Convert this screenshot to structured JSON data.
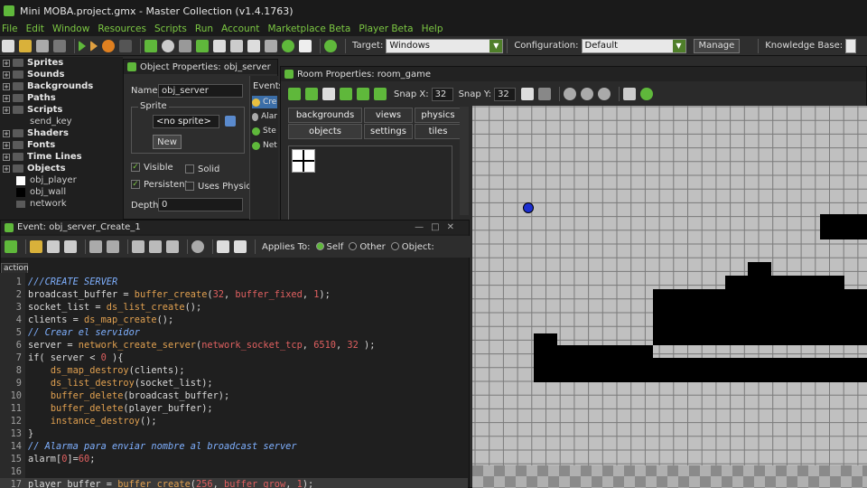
{
  "window": {
    "title": "Mini MOBA.project.gmx  -  Master Collection (v1.4.1763)"
  },
  "menu": [
    "File",
    "Edit",
    "Window",
    "Resources",
    "Scripts",
    "Run",
    "Account",
    "Marketplace Beta",
    "Player Beta",
    "Help"
  ],
  "toolbar": {
    "target_label": "Target:",
    "target_value": "Windows",
    "config_label": "Configuration:",
    "config_value": "Default",
    "manage_label": "Manage",
    "kb_label": "Knowledge Base:"
  },
  "tree": [
    {
      "label": "Sprites",
      "level": 0,
      "bold": true
    },
    {
      "label": "Sounds",
      "level": 0,
      "bold": true
    },
    {
      "label": "Backgrounds",
      "level": 0,
      "bold": true
    },
    {
      "label": "Paths",
      "level": 0,
      "bold": true
    },
    {
      "label": "Scripts",
      "level": 0,
      "bold": true
    },
    {
      "label": "send_key",
      "level": 1,
      "bold": false
    },
    {
      "label": "Shaders",
      "level": 0,
      "bold": true
    },
    {
      "label": "Fonts",
      "level": 0,
      "bold": true
    },
    {
      "label": "Time Lines",
      "level": 0,
      "bold": true
    },
    {
      "label": "Objects",
      "level": 0,
      "bold": true
    },
    {
      "label": "obj_player",
      "level": 1,
      "bold": false
    },
    {
      "label": "obj_wall",
      "level": 1,
      "bold": false
    },
    {
      "label": "network",
      "level": 1,
      "bold": false
    }
  ],
  "objprops": {
    "title": "Object Properties: obj_server",
    "name_label": "Name:",
    "name_value": "obj_server",
    "sprite_group": "Sprite",
    "sprite_value": "<no sprite>",
    "new_label": "New",
    "visible_label": "Visible",
    "solid_label": "Solid",
    "persistent_label": "Persistent",
    "physics_label": "Uses Physics",
    "depth_label": "Depth:",
    "depth_value": "0",
    "events_label": "Events:",
    "events": [
      "Cre",
      "Alar",
      "Ste",
      "Net"
    ]
  },
  "roomprops": {
    "title": "Room Properties: room_game",
    "snapx_label": "Snap X:",
    "snapx_value": "32",
    "snapy_label": "Snap Y:",
    "snapy_value": "32",
    "tabs_row1": [
      "backgrounds",
      "views",
      "physics"
    ],
    "tabs_row2": [
      "objects",
      "settings",
      "tiles"
    ]
  },
  "event": {
    "title": "Event: obj_server_Create_1",
    "applies_label": "Applies To:",
    "self_label": "Self",
    "other_label": "Other",
    "object_label": "Object:",
    "tab_label": "action"
  },
  "code": [
    {
      "n": "1",
      "text": "///CREATE SERVER"
    },
    {
      "n": "2",
      "text": "broadcast_buffer = buffer_create(32, buffer_fixed, 1);"
    },
    {
      "n": "3",
      "text": "socket_list = ds_list_create();"
    },
    {
      "n": "4",
      "text": "clients = ds_map_create();"
    },
    {
      "n": "5",
      "text": "// Crear el servidor"
    },
    {
      "n": "6",
      "text": "server = network_create_server(network_socket_tcp, 6510, 32 );"
    },
    {
      "n": "7",
      "text": "if( server < 0 ){"
    },
    {
      "n": "8",
      "text": "    ds_map_destroy(clients);"
    },
    {
      "n": "9",
      "text": "    ds_list_destroy(socket_list);"
    },
    {
      "n": "10",
      "text": "    buffer_delete(broadcast_buffer);"
    },
    {
      "n": "11",
      "text": "    buffer_delete(player_buffer);"
    },
    {
      "n": "12",
      "text": "    instance_destroy();"
    },
    {
      "n": "13",
      "text": "}"
    },
    {
      "n": "14",
      "text": "// Alarma para enviar nombre al broadcast server"
    },
    {
      "n": "15",
      "text": "alarm[0]=60;"
    },
    {
      "n": "16",
      "text": ""
    },
    {
      "n": "17",
      "text": "player_buffer = buffer_create(256, buffer_grow, 1);"
    }
  ],
  "colors": {
    "accent": "#7cc843",
    "code_func": "#e0a050",
    "code_comment": "#7fb0ff",
    "code_number": "#e06060",
    "code_keyword": "#ffe070"
  }
}
